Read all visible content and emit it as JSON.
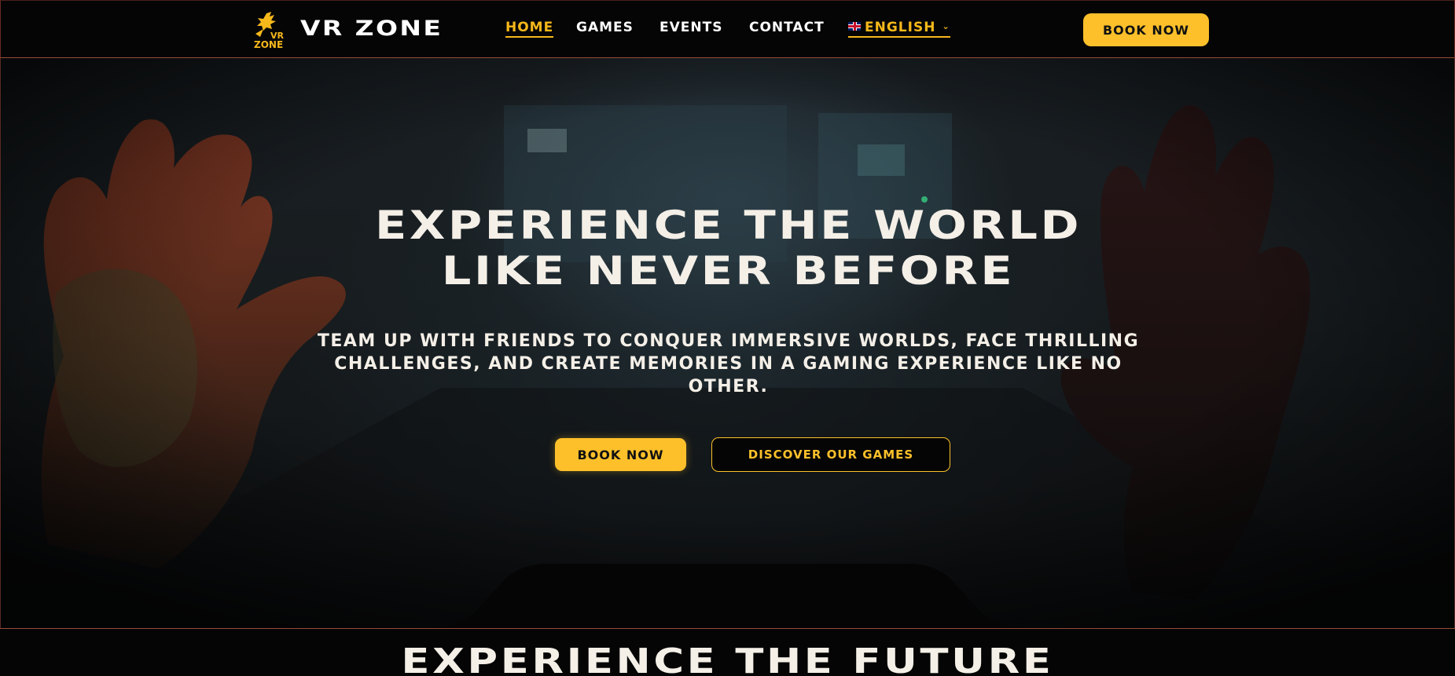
{
  "brand": {
    "logo_text_line1": "VR",
    "logo_text_line2": "ZONE",
    "name": "VR ZONE"
  },
  "nav": {
    "links": [
      {
        "label": "HOME",
        "active": true
      },
      {
        "label": "GAMES",
        "active": false
      },
      {
        "label": "EVENTS",
        "active": false
      },
      {
        "label": "CONTACT",
        "active": false
      }
    ],
    "language": {
      "label": "ENGLISH",
      "flag_icon": "uk-flag-icon"
    },
    "cta_label": "BOOK NOW"
  },
  "hero": {
    "title_line1": "EXPERIENCE THE WORLD",
    "title_line2": "LIKE NEVER BEFORE",
    "subtitle": "TEAM UP WITH FRIENDS TO CONQUER IMMERSIVE WORLDS, FACE THRILLING CHALLENGES, AND CREATE MEMORIES IN A GAMING EXPERIENCE LIKE NO OTHER.",
    "primary_cta": "BOOK NOW",
    "secondary_cta": "DISCOVER OUR GAMES"
  },
  "section2": {
    "title": "EXPERIENCE THE FUTURE"
  },
  "colors": {
    "accent": "#fdc02a",
    "background": "#050505",
    "text": "#f4efe7",
    "border": "#9a4a3a"
  }
}
